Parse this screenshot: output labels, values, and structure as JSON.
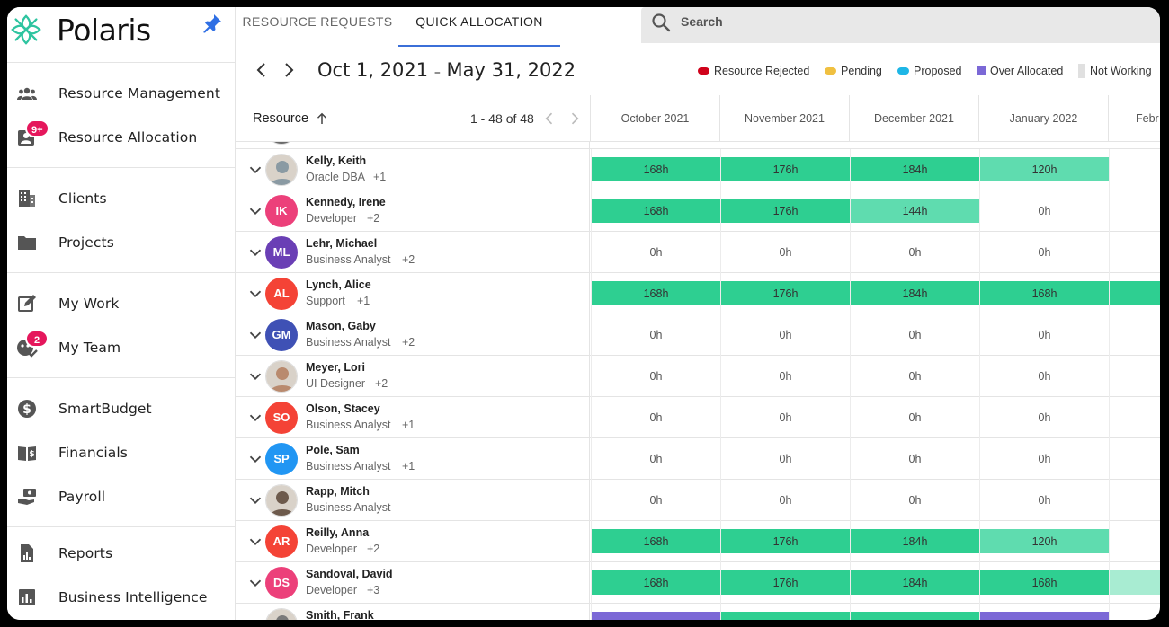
{
  "app": {
    "name": "Polaris"
  },
  "colors": {
    "bar_full": "#2ecf91",
    "bar_partial": "#5fdcaf",
    "bar_light": "#a8ecd2",
    "badge": "#e5175c",
    "accent": "#3b6fd8",
    "rejected": "#d0021b",
    "pending": "#f0c040",
    "proposed": "#1eb6e6",
    "over_allocated": "#7b68d6",
    "not_working": "#e0e0e0"
  },
  "sidebar": {
    "sections": [
      {
        "items": [
          {
            "label": "Resource Management",
            "icon": "people-icon"
          },
          {
            "label": "Resource Allocation",
            "icon": "person-add-icon",
            "badge": "9+"
          }
        ]
      },
      {
        "items": [
          {
            "label": "Clients",
            "icon": "building-icon"
          },
          {
            "label": "Projects",
            "icon": "folder-icon"
          }
        ]
      },
      {
        "items": [
          {
            "label": "My Work",
            "icon": "edit-box-icon"
          },
          {
            "label": "My Team",
            "icon": "team-check-icon",
            "badge": "2"
          }
        ]
      },
      {
        "items": [
          {
            "label": "SmartBudget",
            "icon": "dollar-circle-icon"
          },
          {
            "label": "Financials",
            "icon": "book-dollar-icon"
          },
          {
            "label": "Payroll",
            "icon": "payroll-hand-icon"
          }
        ]
      },
      {
        "items": [
          {
            "label": "Reports",
            "icon": "report-file-icon"
          },
          {
            "label": "Business Intelligence",
            "icon": "bar-chart-icon"
          }
        ]
      }
    ]
  },
  "tabs": [
    {
      "label": "RESOURCE REQUESTS",
      "active": false
    },
    {
      "label": "QUICK ALLOCATION",
      "active": true
    }
  ],
  "search": {
    "placeholder": "Search"
  },
  "date_range": {
    "start": "Oct 1, 2021",
    "separator": "–",
    "end": "May 31, 2022"
  },
  "legend": [
    {
      "label": "Resource Rejected",
      "color": "#d0021b",
      "shape": "pill"
    },
    {
      "label": "Pending",
      "color": "#f0c040",
      "shape": "pill"
    },
    {
      "label": "Proposed",
      "color": "#1eb6e6",
      "shape": "pill"
    },
    {
      "label": "Over Allocated",
      "color": "#7b68d6",
      "shape": "square"
    },
    {
      "label": "Not Working",
      "color": "#e0e0e0",
      "shape": "tall"
    }
  ],
  "grid": {
    "resource_header": "Resource",
    "pager": "1 - 48 of 48",
    "months": [
      "October 2021",
      "November 2021",
      "December 2021",
      "January 2022",
      "Febr"
    ]
  },
  "resources": [
    {
      "name": "Kelly, Keith",
      "role": "Oracle DBA",
      "extra": "+1",
      "avatar": {
        "type": "photo",
        "tone": "#8a9aa3"
      },
      "hours": [
        {
          "v": "168h",
          "s": "full"
        },
        {
          "v": "176h",
          "s": "full"
        },
        {
          "v": "184h",
          "s": "full"
        },
        {
          "v": "120h",
          "s": "partial"
        },
        {
          "v": "",
          "s": "none"
        }
      ]
    },
    {
      "name": "Kennedy, Irene",
      "role": "Developer",
      "extra": "+2",
      "avatar": {
        "type": "initials",
        "text": "IK",
        "color": "#ec407a"
      },
      "hours": [
        {
          "v": "168h",
          "s": "full"
        },
        {
          "v": "176h",
          "s": "full"
        },
        {
          "v": "144h",
          "s": "partial"
        },
        {
          "v": "0h",
          "s": "none"
        },
        {
          "v": "",
          "s": "none"
        }
      ]
    },
    {
      "name": "Lehr, Michael",
      "role": "Business Analyst",
      "extra": "+2",
      "avatar": {
        "type": "initials",
        "text": "ML",
        "color": "#6a3fb5"
      },
      "hours": [
        {
          "v": "0h",
          "s": "none"
        },
        {
          "v": "0h",
          "s": "none"
        },
        {
          "v": "0h",
          "s": "none"
        },
        {
          "v": "0h",
          "s": "none"
        },
        {
          "v": "",
          "s": "none"
        }
      ]
    },
    {
      "name": "Lynch, Alice",
      "role": "Support",
      "extra": "+1",
      "avatar": {
        "type": "initials",
        "text": "AL",
        "color": "#f44336"
      },
      "hours": [
        {
          "v": "168h",
          "s": "full"
        },
        {
          "v": "176h",
          "s": "full"
        },
        {
          "v": "184h",
          "s": "full"
        },
        {
          "v": "168h",
          "s": "full"
        },
        {
          "v": "",
          "s": "full"
        }
      ]
    },
    {
      "name": "Mason, Gaby",
      "role": "Business Analyst",
      "extra": "+2",
      "avatar": {
        "type": "initials",
        "text": "GM",
        "color": "#3f51b5"
      },
      "hours": [
        {
          "v": "0h",
          "s": "none"
        },
        {
          "v": "0h",
          "s": "none"
        },
        {
          "v": "0h",
          "s": "none"
        },
        {
          "v": "0h",
          "s": "none"
        },
        {
          "v": "",
          "s": "none"
        }
      ]
    },
    {
      "name": "Meyer, Lori",
      "role": "UI Designer",
      "extra": "+2",
      "avatar": {
        "type": "photo",
        "tone": "#b98a6e"
      },
      "hours": [
        {
          "v": "0h",
          "s": "none"
        },
        {
          "v": "0h",
          "s": "none"
        },
        {
          "v": "0h",
          "s": "none"
        },
        {
          "v": "0h",
          "s": "none"
        },
        {
          "v": "",
          "s": "none"
        }
      ]
    },
    {
      "name": "Olson, Stacey",
      "role": "Business Analyst",
      "extra": "+1",
      "avatar": {
        "type": "initials",
        "text": "SO",
        "color": "#f44336"
      },
      "hours": [
        {
          "v": "0h",
          "s": "none"
        },
        {
          "v": "0h",
          "s": "none"
        },
        {
          "v": "0h",
          "s": "none"
        },
        {
          "v": "0h",
          "s": "none"
        },
        {
          "v": "",
          "s": "none"
        }
      ]
    },
    {
      "name": "Pole, Sam",
      "role": "Business Analyst",
      "extra": "+1",
      "avatar": {
        "type": "initials",
        "text": "SP",
        "color": "#2196f3"
      },
      "hours": [
        {
          "v": "0h",
          "s": "none"
        },
        {
          "v": "0h",
          "s": "none"
        },
        {
          "v": "0h",
          "s": "none"
        },
        {
          "v": "0h",
          "s": "none"
        },
        {
          "v": "",
          "s": "none"
        }
      ]
    },
    {
      "name": "Rapp, Mitch",
      "role": "Business Analyst",
      "extra": "",
      "avatar": {
        "type": "photo",
        "tone": "#6d5a4c"
      },
      "hours": [
        {
          "v": "0h",
          "s": "none"
        },
        {
          "v": "0h",
          "s": "none"
        },
        {
          "v": "0h",
          "s": "none"
        },
        {
          "v": "0h",
          "s": "none"
        },
        {
          "v": "",
          "s": "none"
        }
      ]
    },
    {
      "name": "Reilly, Anna",
      "role": "Developer",
      "extra": "+2",
      "avatar": {
        "type": "initials",
        "text": "AR",
        "color": "#f44336"
      },
      "hours": [
        {
          "v": "168h",
          "s": "full"
        },
        {
          "v": "176h",
          "s": "full"
        },
        {
          "v": "184h",
          "s": "full"
        },
        {
          "v": "120h",
          "s": "partial"
        },
        {
          "v": "",
          "s": "none"
        }
      ]
    },
    {
      "name": "Sandoval, David",
      "role": "Developer",
      "extra": "+3",
      "avatar": {
        "type": "initials",
        "text": "DS",
        "color": "#ec407a"
      },
      "hours": [
        {
          "v": "168h",
          "s": "full"
        },
        {
          "v": "176h",
          "s": "full"
        },
        {
          "v": "184h",
          "s": "full"
        },
        {
          "v": "168h",
          "s": "full"
        },
        {
          "v": "",
          "s": "light"
        }
      ]
    },
    {
      "name": "Smith, Frank",
      "role": "",
      "extra": "",
      "avatar": {
        "type": "photo",
        "tone": "#7a7a7a"
      },
      "hours": [
        {
          "v": "",
          "s": "over"
        },
        {
          "v": "",
          "s": "full"
        },
        {
          "v": "",
          "s": "full"
        },
        {
          "v": "",
          "s": "over"
        },
        {
          "v": "",
          "s": "none"
        }
      ]
    }
  ]
}
